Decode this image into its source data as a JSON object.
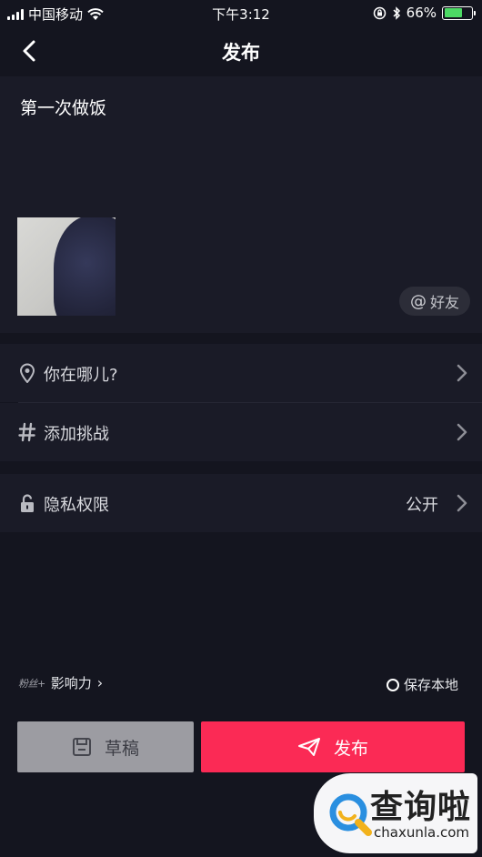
{
  "status_bar": {
    "carrier": "中国移动",
    "time": "下午3:12",
    "battery_percent": "66%",
    "battery_level": 0.66
  },
  "nav": {
    "title": "发布",
    "back_icon": "chevron-left-icon"
  },
  "caption": {
    "text": "第一次做饭",
    "mention_at": "@",
    "mention_label": "好友"
  },
  "rows": {
    "location_label": "你在哪儿?",
    "challenge_label": "添加挑战",
    "privacy_label": "隐私权限",
    "privacy_value": "公开"
  },
  "bottom": {
    "fans_badge": "粉丝+",
    "influence_label": "影响力",
    "influence_chevron": "›",
    "save_local_label": "保存本地",
    "draft_label": "草稿",
    "publish_label": "发布"
  },
  "watermark": {
    "title": "查询啦",
    "domain": "chaxunla.com"
  },
  "colors": {
    "background": "#14151f",
    "card": "#1a1b27",
    "publish": "#fb2a55",
    "draft": "#9c9ca2"
  }
}
